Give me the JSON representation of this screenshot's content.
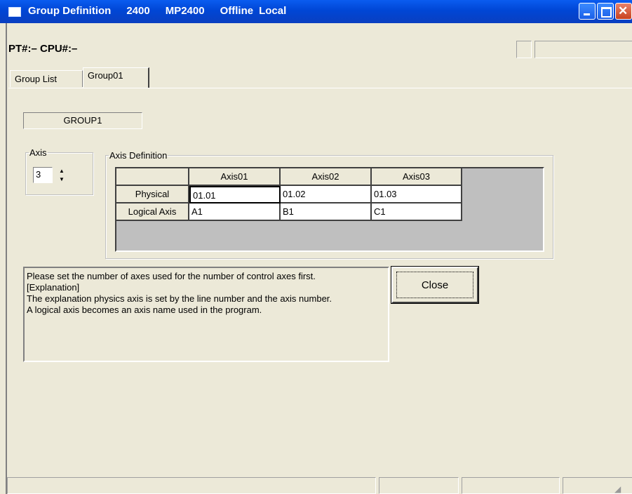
{
  "window": {
    "title_parts": [
      "Group Definition",
      "2400",
      "MP2400",
      "Offline",
      "Local"
    ]
  },
  "info": {
    "pt_cpu": "PT#:– CPU#:–"
  },
  "tabs": [
    {
      "label": "Group List",
      "active": false
    },
    {
      "label": "Group01",
      "active": true
    }
  ],
  "group": {
    "name": "GROUP1"
  },
  "axis_box": {
    "label": "Axis",
    "value": "3"
  },
  "axis_definition": {
    "label": "Axis Definition",
    "columns": [
      "Axis01",
      "Axis02",
      "Axis03"
    ],
    "rows": [
      {
        "label": "Physical",
        "values": [
          "01.01",
          "01.02",
          "01.03"
        ]
      },
      {
        "label": "Logical Axis",
        "values": [
          "A1",
          "B1",
          "C1"
        ]
      }
    ]
  },
  "explanation": [
    "Please set the number of axes used for the number of control axes first.",
    "[Explanation]",
    "The explanation physics axis is set by the line number and the axis number.",
    "A logical axis becomes an axis name used in the program."
  ],
  "buttons": {
    "close": "Close"
  }
}
